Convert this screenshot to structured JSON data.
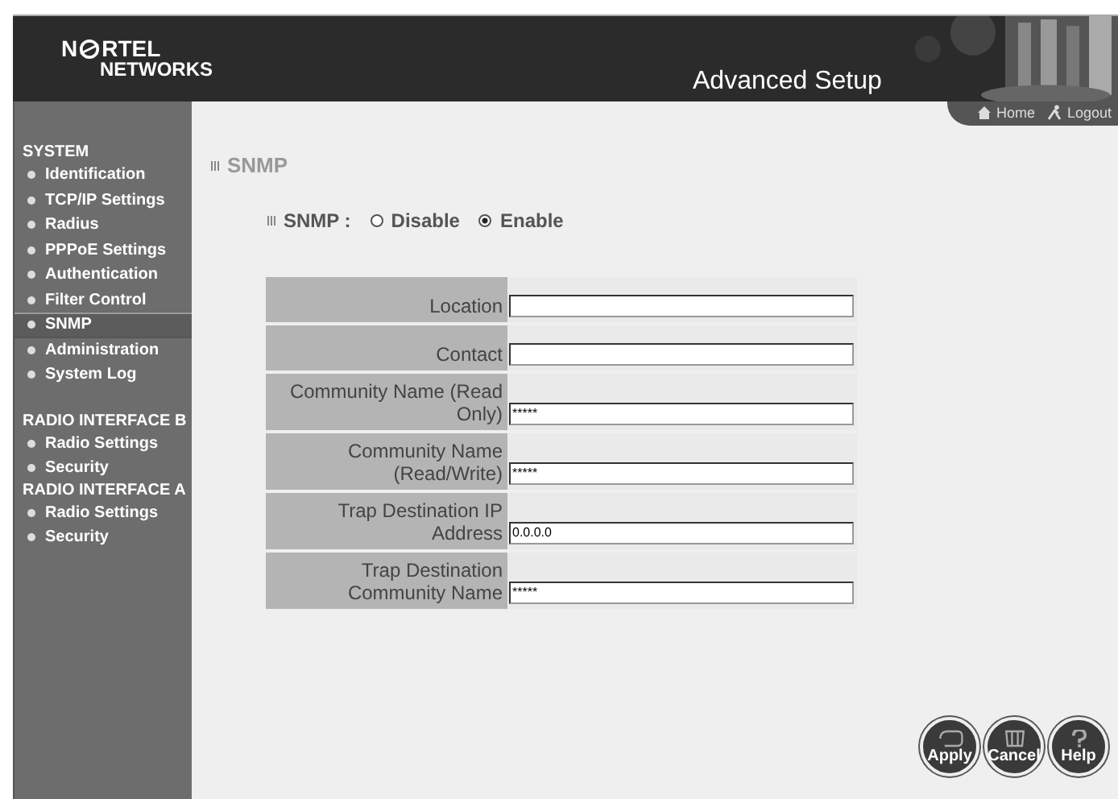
{
  "header": {
    "logo": {
      "start": "N",
      "end": "RTEL",
      "line_2": "NETWORKS"
    },
    "title": "Advanced Setup"
  },
  "top_links": [
    {
      "label": "Home",
      "kind": "home"
    },
    {
      "label": "Logout",
      "kind": "logout"
    }
  ],
  "sidebar": {
    "sections": [
      {
        "title": "SYSTEM",
        "items": [
          {
            "label": "Identification",
            "selected": false
          },
          {
            "label": "TCP/IP Settings",
            "selected": false
          },
          {
            "label": "Radius",
            "selected": false
          },
          {
            "label": "PPPoE Settings",
            "selected": false
          },
          {
            "label": "Authentication",
            "selected": false
          },
          {
            "label": "Filter Control",
            "selected": false
          },
          {
            "label": "SNMP",
            "selected": true
          },
          {
            "label": "Administration",
            "selected": false
          },
          {
            "label": "System Log",
            "selected": false
          }
        ]
      },
      {
        "title": "RADIO INTERFACE B",
        "items": [
          {
            "label": "Radio Settings",
            "selected": false
          },
          {
            "label": "Security",
            "selected": false
          }
        ]
      },
      {
        "title": "RADIO INTERFACE A",
        "items": [
          {
            "label": "Radio Settings",
            "selected": false
          },
          {
            "label": "Security",
            "selected": false
          }
        ]
      }
    ]
  },
  "page_title": "SNMP",
  "snmp_setting": {
    "label": "SNMP :",
    "options": [
      {
        "label": "Disable",
        "selected": false
      },
      {
        "label": "Enable",
        "selected": true
      }
    ]
  },
  "form": {
    "rows": [
      {
        "label": "Location",
        "value": ""
      },
      {
        "label": "Contact",
        "value": ""
      },
      {
        "label": "Community Name (Read Only)",
        "value": "*****"
      },
      {
        "label": "Community Name (Read/Write)",
        "value": "*****"
      },
      {
        "label": "Trap Destination IP Address",
        "value": "0.0.0.0"
      },
      {
        "label": "Trap Destination Community Name",
        "value": "*****"
      }
    ]
  },
  "buttons": [
    {
      "label": "Apply",
      "kind": "apply"
    },
    {
      "label": "Cancel",
      "kind": "cancel"
    },
    {
      "label": "Help",
      "kind": "help"
    }
  ]
}
